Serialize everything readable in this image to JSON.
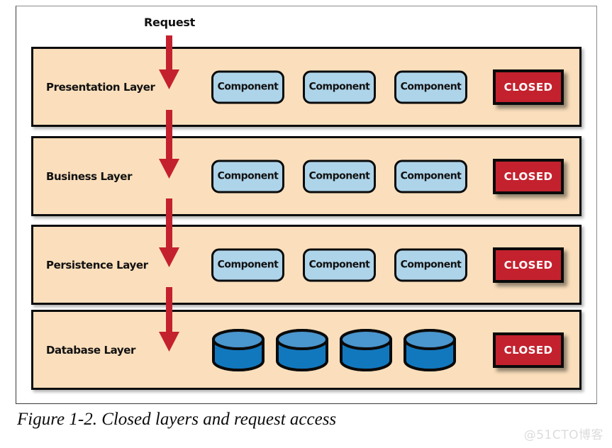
{
  "figure": {
    "caption": "Figure 1-2. Closed layers and request access",
    "watermark": "@51CTO博客"
  },
  "colors": {
    "layer_band_fill": "#fbdfbc",
    "layer_border": "#0d0d0d",
    "component_fill": "#aed4ea",
    "closed_badge_fill": "#c4212e",
    "closed_badge_text": "#ffffff",
    "arrow": "#c4212e",
    "cylinder_top": "#4a96ce",
    "cylinder_body": "#1278be",
    "frame_border": "#3a3a3a",
    "watermark": "#dcdcdc"
  },
  "request": {
    "label": "Request"
  },
  "layers": [
    {
      "name": "Presentation Layer",
      "content_type": "components",
      "components": [
        "Component",
        "Component",
        "Component"
      ],
      "badge": "CLOSED"
    },
    {
      "name": "Business Layer",
      "content_type": "components",
      "components": [
        "Component",
        "Component",
        "Component"
      ],
      "badge": "CLOSED"
    },
    {
      "name": "Persistence Layer",
      "content_type": "components",
      "components": [
        "Component",
        "Component",
        "Component"
      ],
      "badge": "CLOSED"
    },
    {
      "name": "Database Layer",
      "content_type": "databases",
      "databases": [
        "database-cylinder",
        "database-cylinder",
        "database-cylinder",
        "database-cylinder"
      ],
      "badge": "CLOSED"
    }
  ]
}
